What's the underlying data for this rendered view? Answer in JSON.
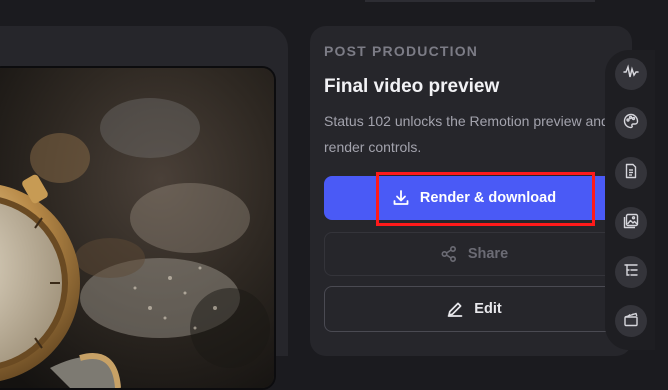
{
  "panel": {
    "eyebrow": "POST PRODUCTION",
    "title": "Final video preview",
    "description": "Status 102 unlocks the Remotion preview and render controls."
  },
  "actions": {
    "render_label": "Render & download",
    "share_label": "Share",
    "edit_label": "Edit"
  },
  "toolbar": {
    "icons": [
      "waveform-icon",
      "palette-icon",
      "document-icon",
      "image-gallery-icon",
      "list-tree-icon",
      "clapperboard-icon"
    ]
  },
  "colors": {
    "accent": "#4a5af6",
    "highlight": "#ff1a1a",
    "background": "#1b1b1f",
    "panel": "#26262b"
  }
}
